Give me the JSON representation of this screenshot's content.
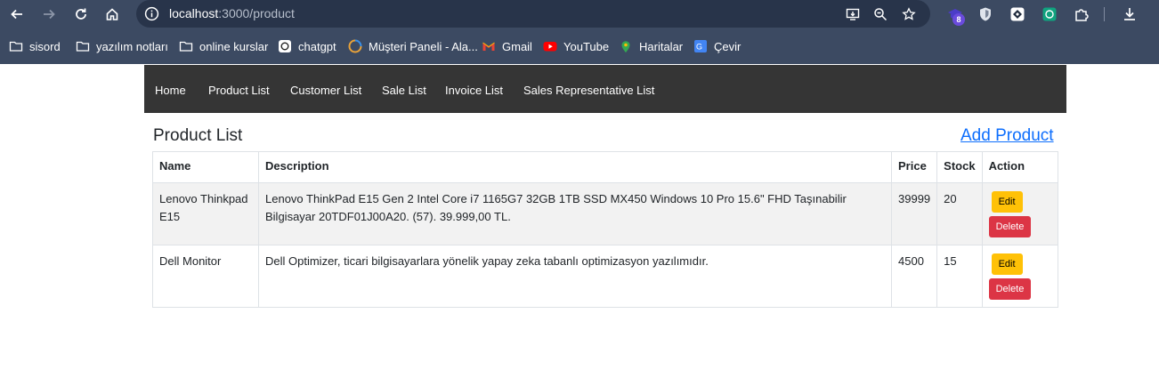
{
  "browser": {
    "url_host": "localhost",
    "url_path": ":3000/product",
    "extension_badge": "8",
    "bookmarks": [
      {
        "label": "sisord",
        "icon": "folder-icon"
      },
      {
        "label": "yazılım notları",
        "icon": "folder-icon"
      },
      {
        "label": "online kurslar",
        "icon": "folder-icon"
      },
      {
        "label": "chatgpt",
        "icon": "chatgpt-icon"
      },
      {
        "label": "Müşteri Paneli - Ala...",
        "icon": "panel-icon"
      },
      {
        "label": "Gmail",
        "icon": "gmail-icon"
      },
      {
        "label": "YouTube",
        "icon": "youtube-icon"
      },
      {
        "label": "Haritalar",
        "icon": "maps-icon"
      },
      {
        "label": "Çevir",
        "icon": "translate-icon"
      }
    ]
  },
  "nav": {
    "items": [
      "Home",
      "Product List",
      "Customer List",
      "Sale List",
      "Invoice List",
      "Sales Representative List"
    ]
  },
  "page": {
    "title": "Product List",
    "add_link": "Add Product"
  },
  "table": {
    "headers": {
      "name": "Name",
      "description": "Description",
      "price": "Price",
      "stock": "Stock",
      "action": "Action"
    },
    "rows": [
      {
        "name": "Lenovo Thinkpad E15",
        "description": "Lenovo ThinkPad E15 Gen 2 Intel Core i7 1165G7 32GB 1TB SSD MX450 Windows 10 Pro 15.6\" FHD Taşınabilir Bilgisayar 20TDF01J00A20. (57). 39.999,00 TL.",
        "price": "39999",
        "stock": "20",
        "edit_label": "Edit",
        "delete_label": "Delete"
      },
      {
        "name": "Dell Monitor",
        "description": "Dell Optimizer, ticari bilgisayarlara yönelik yapay zeka tabanlı optimizasyon yazılımıdır.",
        "price": "4500",
        "stock": "15",
        "edit_label": "Edit",
        "delete_label": "Delete"
      }
    ]
  },
  "colors": {
    "chrome": "#3c4a62",
    "navbar": "#353535",
    "link": "#0d6efd",
    "edit": "#ffc107",
    "delete": "#dc3545"
  }
}
